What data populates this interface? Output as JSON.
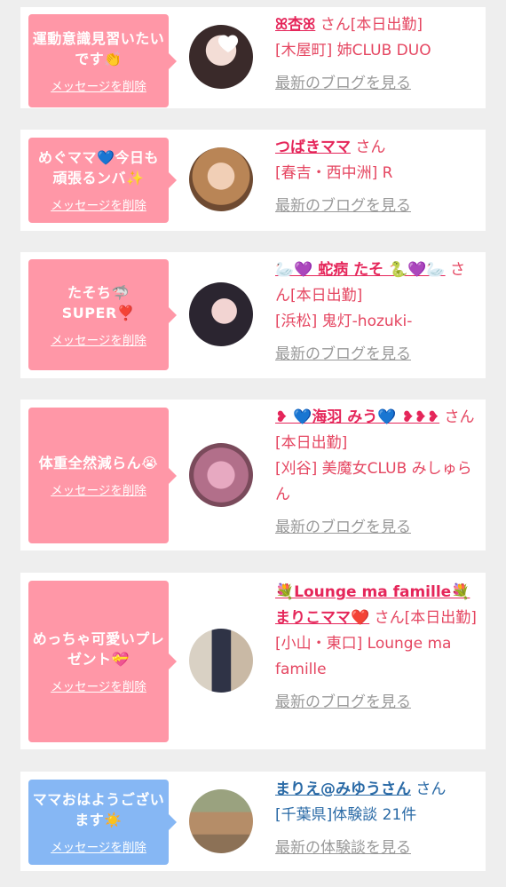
{
  "cards": [
    {
      "bubble": "運動意識見習いたいです👏",
      "delete_label": "メッセージを削除",
      "name": "ꕤ杏ꕤ",
      "suffix": " さん[本日出勤]",
      "place": "[木屋町] 姉CLUB DUO",
      "blog": "最新のブログを見る"
    },
    {
      "bubble": "めぐママ💙今日も頑張るンバ✨",
      "delete_label": "メッセージを削除",
      "name": "つばきママ",
      "suffix": " さん",
      "place": "[春吉・西中洲] R",
      "blog": "最新のブログを見る"
    },
    {
      "bubble": "たそち🦈 SUPER❣️",
      "delete_label": "メッセージを削除",
      "name": "🦢💜 蛇病 たそ 🐍💜🦢",
      "suffix": " さん[本日出勤]",
      "place": "[浜松] 鬼灯-hozuki-",
      "blog": "最新のブログを見る"
    },
    {
      "bubble": "体重全然減らん😭",
      "delete_label": "メッセージを削除",
      "name": "❥ 💙海羽 みう💙 ❥❥❥",
      "suffix": " さん[本日出勤]",
      "place": "[刈谷] 美魔女CLUB みしゅらん",
      "blog": "最新のブログを見る"
    },
    {
      "bubble": "めっちゃ可愛いプレゼント💝",
      "delete_label": "メッセージを削除",
      "name": "💐Lounge ma famille💐まりこママ❤️",
      "suffix": " さん[本日出勤]",
      "place": "[小山・東口] Lounge ma famille",
      "blog": "最新のブログを見る"
    },
    {
      "bubble": "ママおはようございます☀️",
      "delete_label": "メッセージを削除",
      "name": "まりえ@みゆうさん",
      "suffix": " さん",
      "place": "[千葉県]体験談 21件",
      "blog": "最新の体験談を見る"
    }
  ],
  "colors": {
    "bubble_pink": "#ff97a7",
    "bubble_blue": "#86b7f4",
    "name_pink": "#e5265a",
    "name_blue": "#2a6aa6",
    "link_gray": "#999999"
  }
}
